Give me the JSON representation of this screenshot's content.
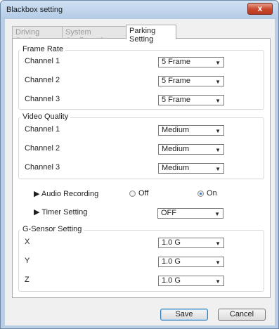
{
  "window": {
    "title": "Blackbox setting",
    "close_label": "x"
  },
  "tabs": [
    {
      "label": "Driving Setting",
      "active": false
    },
    {
      "label": "System Configuration",
      "active": false
    },
    {
      "label": "Parking Setting",
      "active": true
    }
  ],
  "frame_rate": {
    "title": "Frame Rate",
    "rows": [
      {
        "label": "Channel 1",
        "value": "5 Frame"
      },
      {
        "label": "Channel 2",
        "value": "5 Frame"
      },
      {
        "label": "Channel 3",
        "value": "5 Frame"
      }
    ]
  },
  "video_quality": {
    "title": "Video Quality",
    "rows": [
      {
        "label": "Channel 1",
        "value": "Medium"
      },
      {
        "label": "Channel 2",
        "value": "Medium"
      },
      {
        "label": "Channel 3",
        "value": "Medium"
      }
    ]
  },
  "audio_recording": {
    "label": "▶ Audio Recording",
    "off_label": "Off",
    "on_label": "On",
    "selected": "On"
  },
  "timer_setting": {
    "label": "▶ Timer Setting",
    "value": "OFF"
  },
  "g_sensor": {
    "title": "G-Sensor Setting",
    "rows": [
      {
        "label": "X",
        "value": "1.0 G"
      },
      {
        "label": "Y",
        "value": "1.0 G"
      },
      {
        "label": "Z",
        "value": "1.0 G"
      }
    ]
  },
  "buttons": {
    "save": "Save",
    "cancel": "Cancel"
  },
  "icons": {
    "dropdown": "chevron-down-icon",
    "close": "close-icon"
  }
}
